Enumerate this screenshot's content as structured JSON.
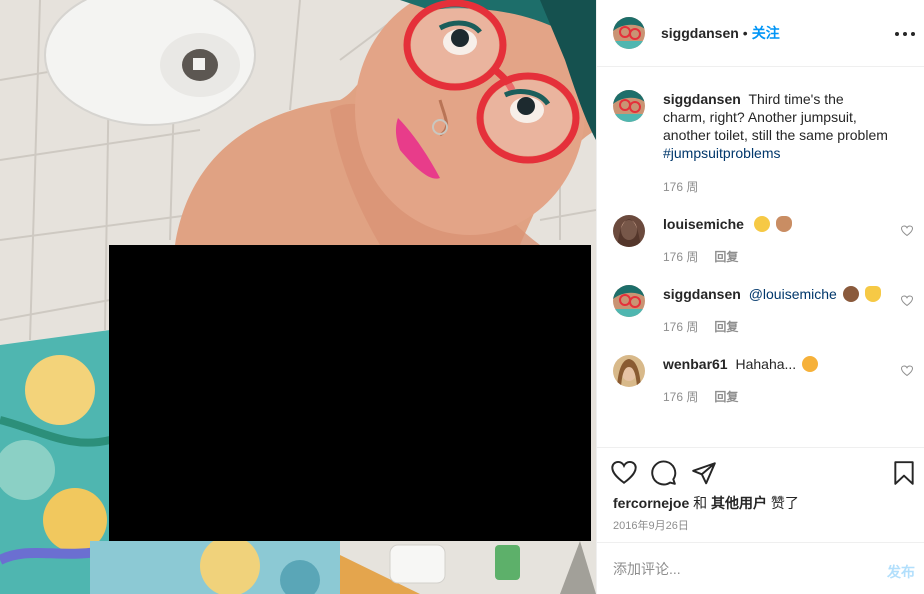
{
  "post": {
    "author": "siggdansen",
    "dot": "•",
    "follow_label": "关注"
  },
  "comments": [
    {
      "user": "siggdansen",
      "text_before_tag": "Third time's the charm, right? Another jumpsuit, another toilet, still the same problem",
      "hashtag": "#jumpsuitproblems",
      "time": "176 周",
      "reply_label": ""
    },
    {
      "user": "louisemiche",
      "text": "",
      "emojis": [
        "grinning-sweat-emoji",
        "hand-emoji"
      ],
      "time": "176 周",
      "reply_label": "回复"
    },
    {
      "user": "siggdansen",
      "mention": "@louisemiche",
      "emojis": [
        "see-no-evil-monkey-emoji",
        "cat-emoji"
      ],
      "time": "176 周",
      "reply_label": "回复"
    },
    {
      "user": "wenbar61",
      "text": "Hahaha...",
      "emojis": [
        "tongue-face-emoji"
      ],
      "time": "176 周",
      "reply_label": "回复"
    }
  ],
  "actions": {
    "liked_by": "fercornejoe",
    "and": "和",
    "others": "其他用户",
    "liked": "赞了",
    "date": "2016年9月26日"
  },
  "add_comment": {
    "placeholder": "添加评论...",
    "post_label": "发布"
  },
  "colors": {
    "link": "#00376b",
    "follow": "#0095f6",
    "post_disabled": "#b2dffc",
    "muted": "#8e8e8e"
  }
}
